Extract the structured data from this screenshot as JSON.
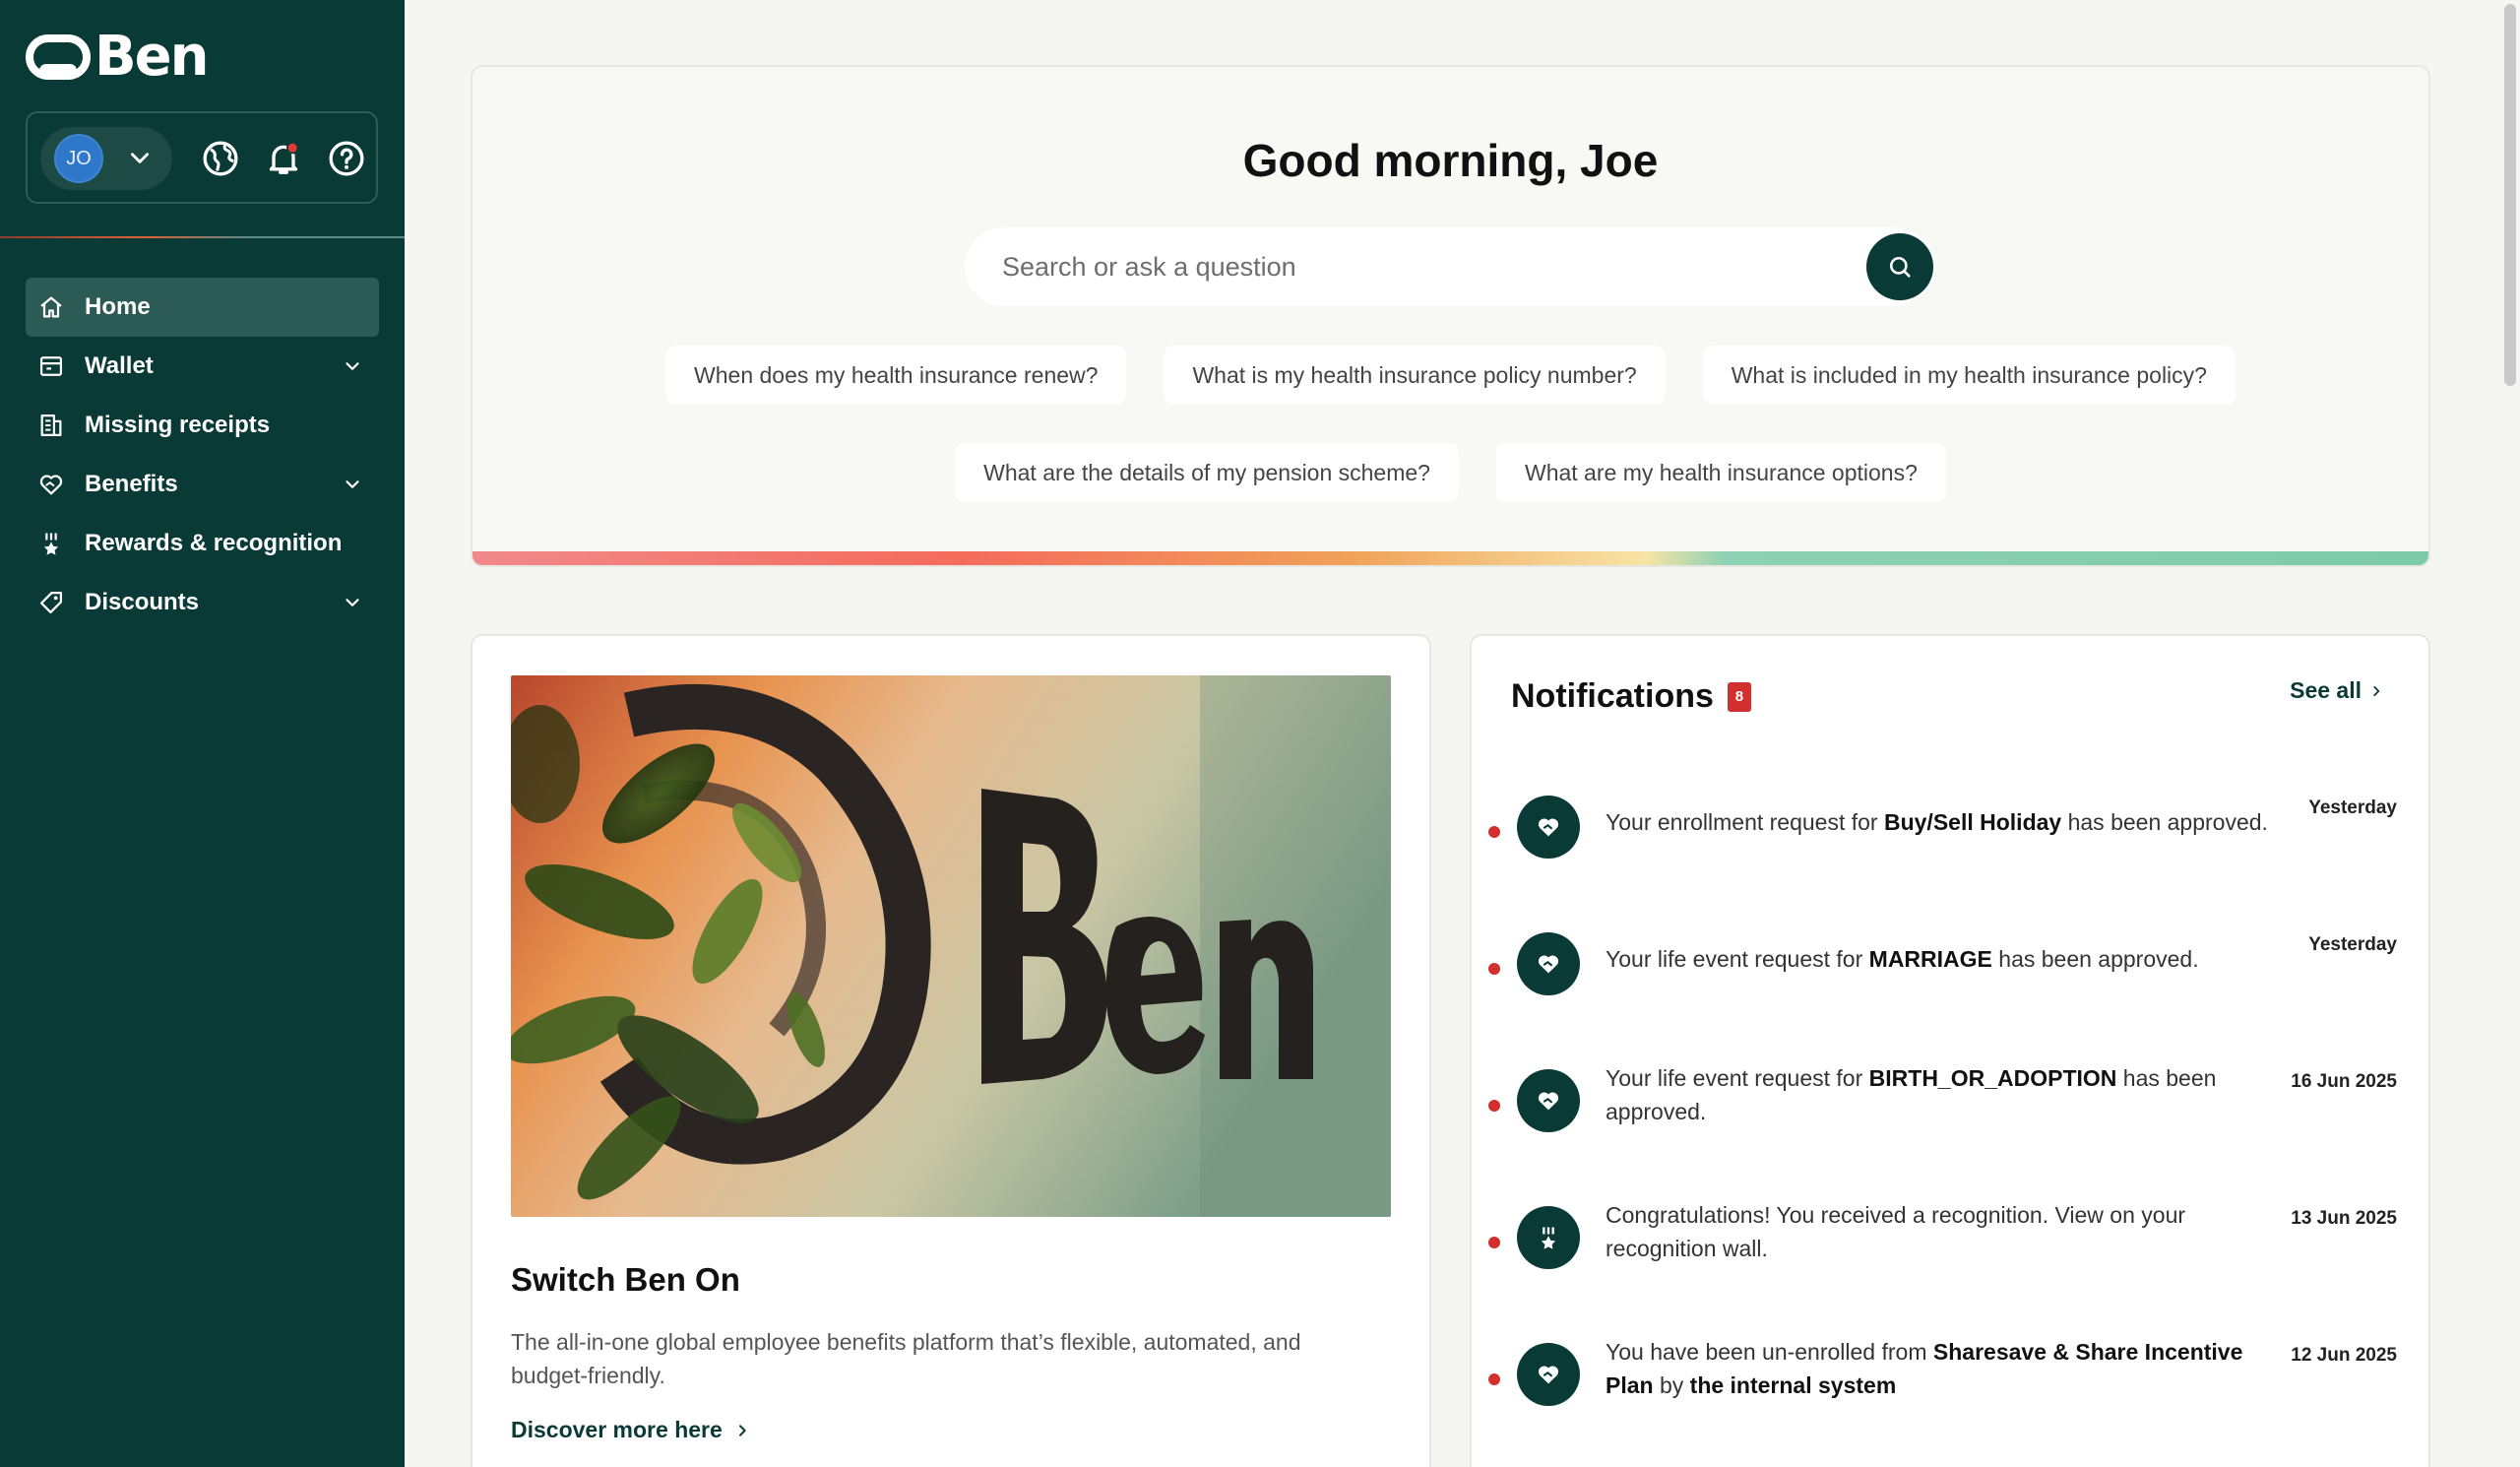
{
  "brand": {
    "name": "Ben",
    "primary": "#0a3a36",
    "accent_red": "#d32f2f"
  },
  "user": {
    "initials": "JO"
  },
  "sidebar": {
    "items": [
      {
        "label": "Home",
        "icon": "home-icon",
        "active": true,
        "expandable": false
      },
      {
        "label": "Wallet",
        "icon": "wallet-icon",
        "active": false,
        "expandable": true
      },
      {
        "label": "Missing receipts",
        "icon": "receipt-icon",
        "active": false,
        "expandable": false
      },
      {
        "label": "Benefits",
        "icon": "heart-hand-icon",
        "active": false,
        "expandable": true
      },
      {
        "label": "Rewards & recognition",
        "icon": "medal-icon",
        "active": false,
        "expandable": false
      },
      {
        "label": "Discounts",
        "icon": "tag-icon",
        "active": false,
        "expandable": true
      }
    ]
  },
  "hero": {
    "greeting": "Good morning, Joe",
    "search_placeholder": "Search or ask a question",
    "suggestions_row1": [
      "When does my health insurance renew?",
      "What is my health insurance policy number?",
      "What is included in my health insurance policy?"
    ],
    "suggestions_row2": [
      "What are the details of my pension scheme?",
      "What are my health insurance options?"
    ]
  },
  "promo": {
    "title": "Switch Ben On",
    "description": "The all-in-one global employee benefits platform that’s flexible, automated, and budget-friendly.",
    "link": "Discover more here",
    "image_sign_text": "Ben"
  },
  "notifications": {
    "title": "Notifications",
    "count": "8",
    "see_all": "See all",
    "items": [
      {
        "icon": "heart-hand-icon",
        "parts": [
          "Your enrollment request for ",
          "Buy/Sell Holiday",
          " has been approved.",
          "",
          ""
        ],
        "date": "Yesterday"
      },
      {
        "icon": "heart-hand-icon",
        "parts": [
          "Your life event request for ",
          "MARRIAGE",
          " has been approved.",
          "",
          ""
        ],
        "date": "Yesterday"
      },
      {
        "icon": "heart-hand-icon",
        "parts": [
          "Your life event request for ",
          "BIRTH_OR_ADOPTION",
          " has been approved.",
          "",
          ""
        ],
        "date": "16 Jun 2025"
      },
      {
        "icon": "medal-icon",
        "parts": [
          "Congratulations! You received a recognition. View on your recognition wall.",
          "",
          "",
          "",
          ""
        ],
        "date": "13 Jun 2025"
      },
      {
        "icon": "heart-hand-icon",
        "parts": [
          "You have been un-enrolled from ",
          "Sharesave & Share Incentive Plan",
          " by ",
          "the internal system",
          ""
        ],
        "date": "12 Jun 2025"
      }
    ]
  }
}
